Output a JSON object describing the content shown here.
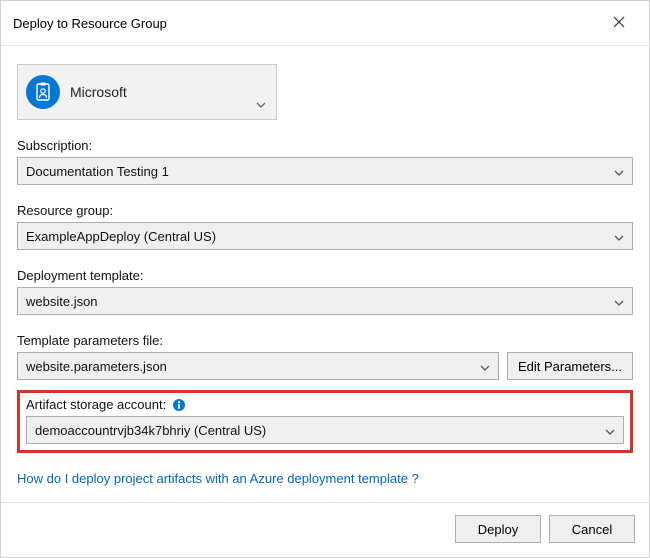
{
  "window": {
    "title": "Deploy to Resource Group"
  },
  "account": {
    "display_name": "Microsoft",
    "badge_icon": "id-badge-icon"
  },
  "fields": {
    "subscription": {
      "label": "Subscription:",
      "value": "Documentation Testing 1"
    },
    "resource_group": {
      "label": "Resource group:",
      "value": "ExampleAppDeploy (Central US)"
    },
    "deployment_template": {
      "label": "Deployment template:",
      "value": "website.json"
    },
    "template_parameters": {
      "label": "Template parameters file:",
      "value": "website.parameters.json",
      "edit_button": "Edit Parameters..."
    },
    "artifact_storage": {
      "label": "Artifact storage account:",
      "value": "demoaccountrvjb34k7bhriy (Central US)"
    }
  },
  "help_link": "How do I deploy project artifacts with an Azure deployment template ?",
  "buttons": {
    "deploy": "Deploy",
    "cancel": "Cancel"
  }
}
